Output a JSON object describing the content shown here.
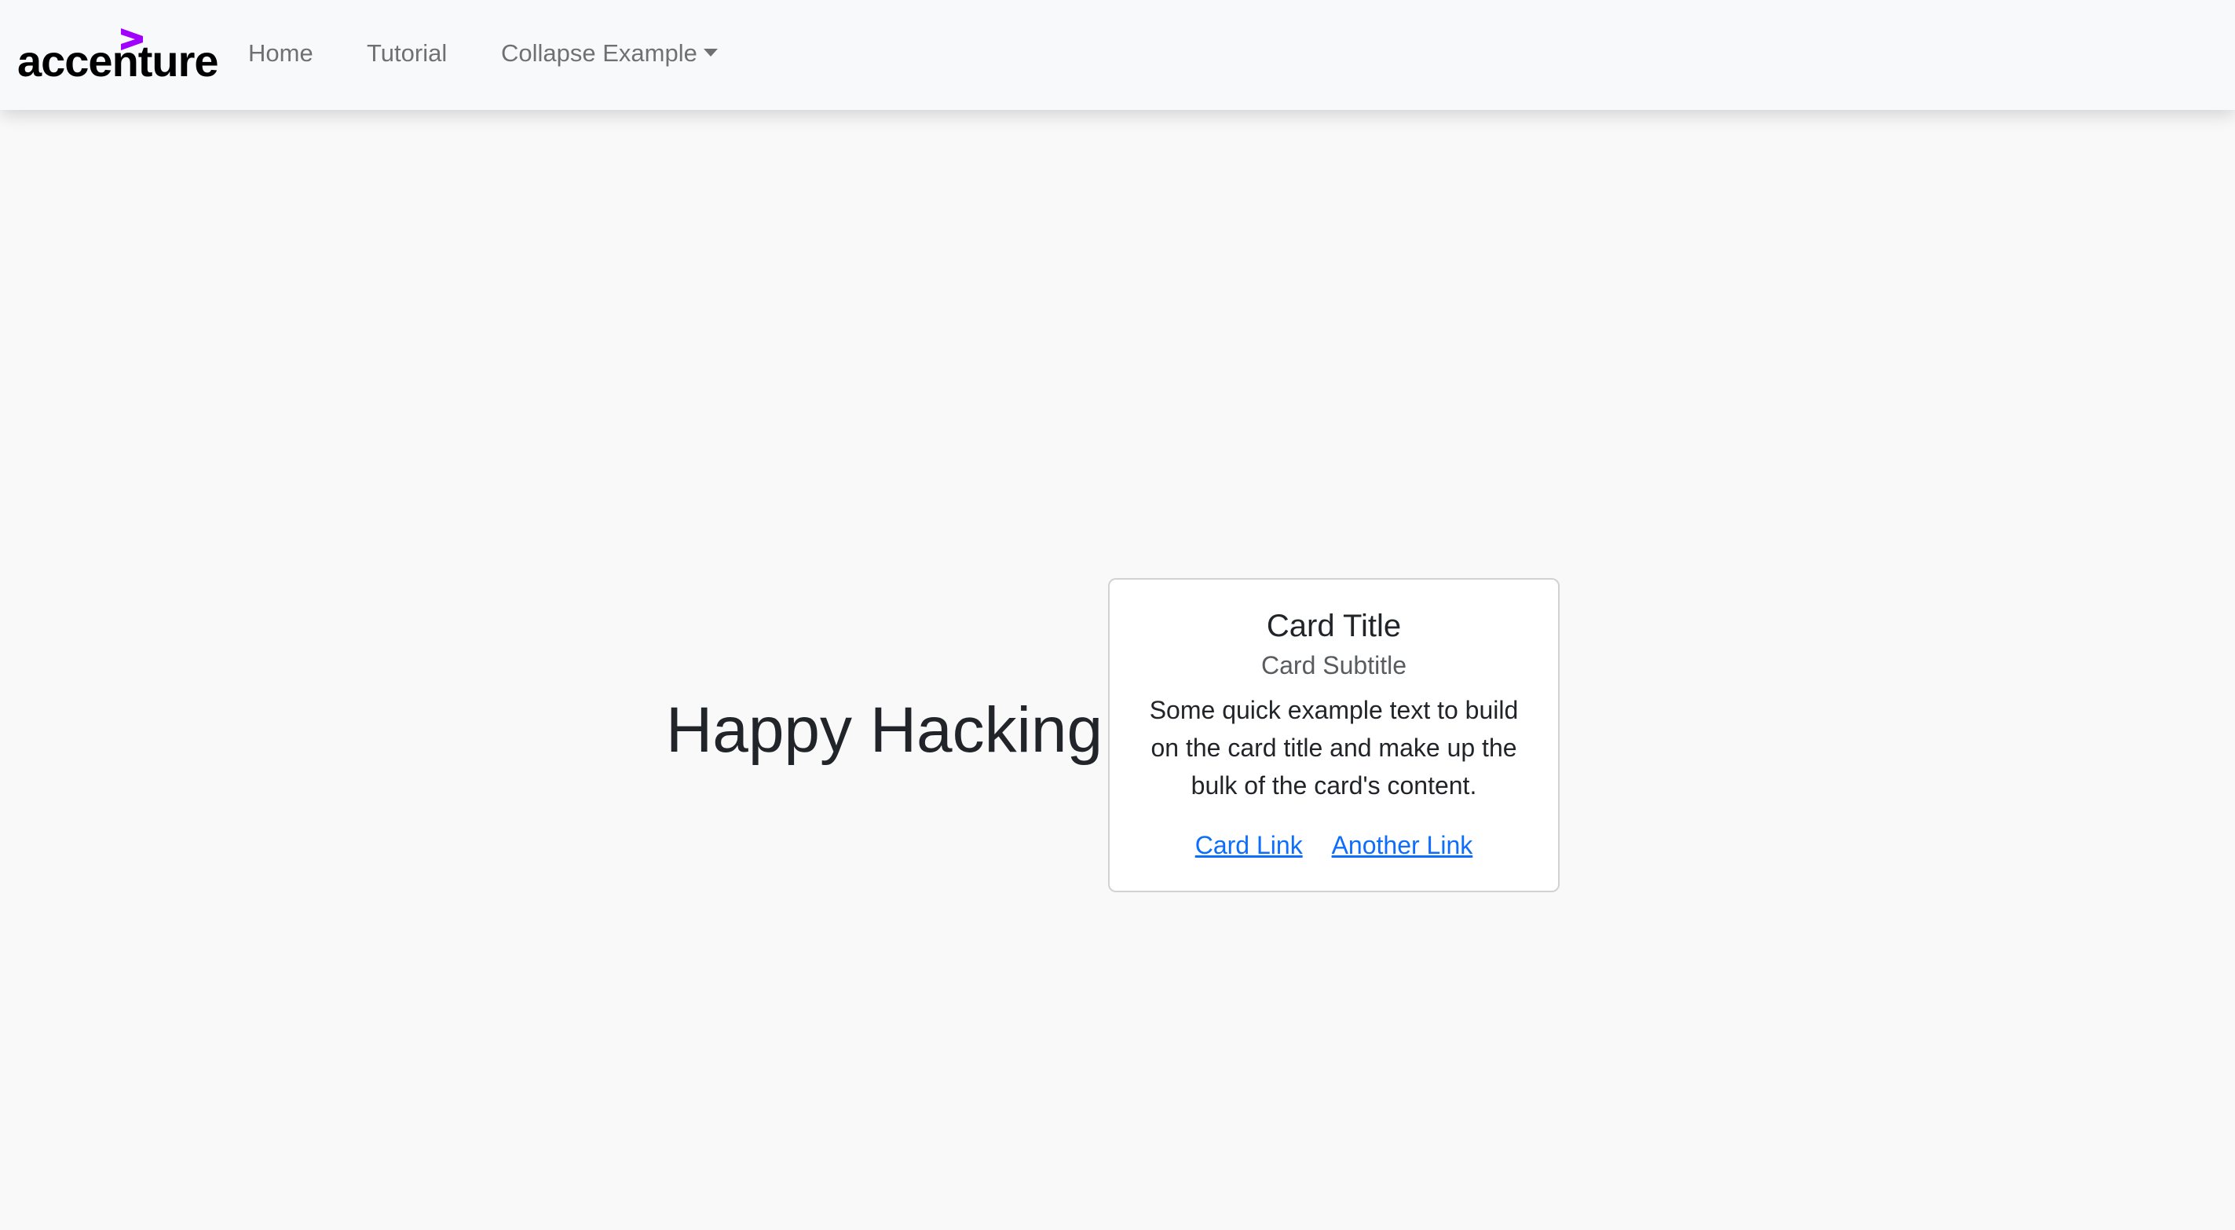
{
  "navbar": {
    "brand": "accenture",
    "brand_accent_color": "#a100ff",
    "items": [
      {
        "label": "Home"
      },
      {
        "label": "Tutorial"
      },
      {
        "label": "Collapse Example"
      }
    ]
  },
  "main": {
    "heading": "Happy Hacking!"
  },
  "card": {
    "title": "Card Title",
    "subtitle": "Card Subtitle",
    "text": "Some quick example text to build on the card title and make up the bulk of the card's content.",
    "links": [
      {
        "label": "Card Link"
      },
      {
        "label": "Another Link"
      }
    ]
  },
  "colors": {
    "link": "#0d6efd",
    "navbar_bg": "#f8f9fa",
    "page_bg": "#f9f9f9"
  }
}
